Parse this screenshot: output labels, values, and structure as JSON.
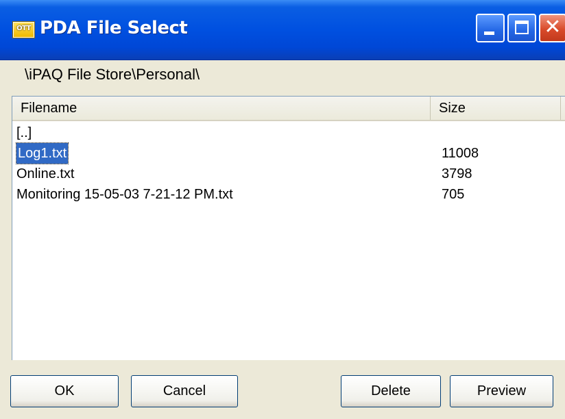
{
  "window": {
    "title": "PDA File Select",
    "app_icon_text": "OTT"
  },
  "path": "\\iPAQ File Store\\Personal\\",
  "list": {
    "columns": [
      "Filename",
      "Size"
    ],
    "rows": [
      {
        "name": "[..]",
        "size": ""
      },
      {
        "name": "Log1.txt",
        "size": "11008",
        "selected": true
      },
      {
        "name": "Online.txt",
        "size": "3798"
      },
      {
        "name": "Monitoring 15-05-03 7-21-12 PM.txt",
        "size": "705"
      }
    ]
  },
  "buttons": {
    "ok": "OK",
    "cancel": "Cancel",
    "delete": "Delete",
    "preview": "Preview"
  },
  "colors": {
    "titlebar": "#0050E0",
    "selection": "#316AC5",
    "close_button": "#D94B2B",
    "face": "#ECE9D8"
  }
}
